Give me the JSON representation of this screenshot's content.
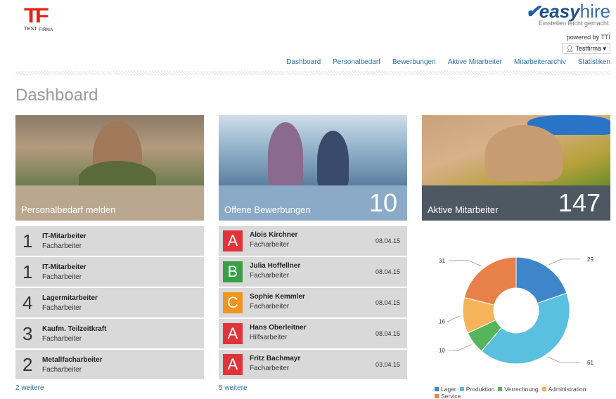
{
  "brand_left": {
    "mark": "TF",
    "sub_a": "TEST",
    "sub_b": "FIRMA"
  },
  "brand_right": {
    "easy": "easy",
    "hire": "hire",
    "tagline": "Einstellen leicht gemacht.",
    "powered": "powered by TTI"
  },
  "user_menu": {
    "label": "Testfirma",
    "icon": "user-icon",
    "caret": "▾"
  },
  "nav": [
    "Dashboard",
    "Personalbedarf",
    "Bewerbungen",
    "Aktive Mitarbeiter",
    "Mitarbeiterarchiv",
    "Statistiken"
  ],
  "page_title": "Dashboard",
  "cards": {
    "personalbedarf": {
      "title": "Personalbedarf melden",
      "rows": [
        {
          "num": "1",
          "title": "IT-Mitarbeiter",
          "sub": "Facharbeiter"
        },
        {
          "num": "1",
          "title": "IT-Mitarbeiter",
          "sub": "Facharbeiter"
        },
        {
          "num": "4",
          "title": "Lagermitarbeiter",
          "sub": "Facharbeiter"
        },
        {
          "num": "3",
          "title": "Kaufm. Teilzeitkraft",
          "sub": "Facharbeiter"
        },
        {
          "num": "2",
          "title": "Metallfacharbeiter",
          "sub": "Facharbeiter"
        }
      ],
      "more": "2 weitere"
    },
    "bewerbungen": {
      "title": "Offene Bewerbungen",
      "count": "10",
      "rows": [
        {
          "grade": "A",
          "color": "#e0343a",
          "name": "Alois Kirchner",
          "sub": "Facharbeiter",
          "date": "08.04.15"
        },
        {
          "grade": "B",
          "color": "#3aa048",
          "name": "Julia Hoffellner",
          "sub": "Facharbeiter",
          "date": "08.04.15"
        },
        {
          "grade": "C",
          "color": "#f2951e",
          "name": "Sophie Kemmler",
          "sub": "Facharbeiter",
          "date": "08.04.15"
        },
        {
          "grade": "A",
          "color": "#e0343a",
          "name": "Hans Oberleitner",
          "sub": "Hilfsarbeiter",
          "date": "08.04.15"
        },
        {
          "grade": "A",
          "color": "#e0343a",
          "name": "Fritz Bachmayr",
          "sub": "Facharbeiter",
          "date": "03.04.15"
        }
      ],
      "more": "5 weitere"
    },
    "mitarbeiter": {
      "title": "Aktive Mitarbeiter",
      "count": "147"
    }
  },
  "chart_data": {
    "type": "pie",
    "donut": true,
    "categories": [
      "Lager",
      "Produktion",
      "Verrechnung",
      "Administration",
      "Service"
    ],
    "values": [
      29,
      61,
      10,
      16,
      31
    ],
    "colors": [
      "#3f85c9",
      "#5bbfe0",
      "#55b55a",
      "#f5b45a",
      "#e8804a"
    ],
    "legend_position": "bottom"
  }
}
